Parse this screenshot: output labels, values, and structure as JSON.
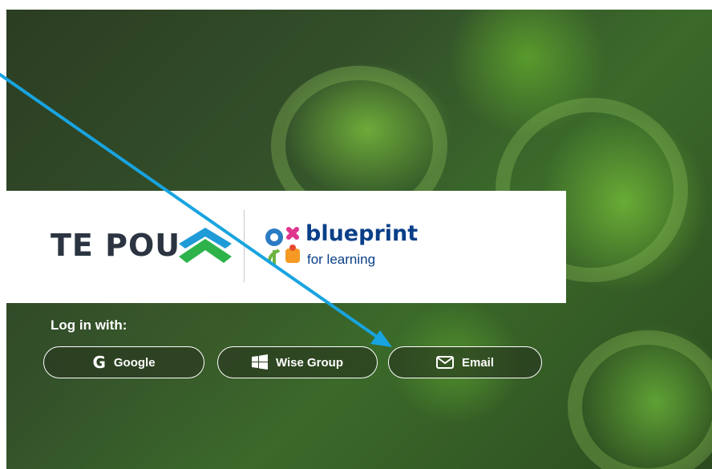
{
  "banner": {
    "left_brand": "TE POU",
    "right_brand_name": "blueprint",
    "right_brand_tagline": "for learning"
  },
  "login": {
    "label": "Log in with:",
    "buttons": [
      {
        "label": "Google",
        "icon": "google-g-icon"
      },
      {
        "label": "Wise Group",
        "icon": "windows-icon"
      },
      {
        "label": "Email",
        "icon": "envelope-icon"
      }
    ]
  },
  "annotation": {
    "arrow_color": "#18a4e0"
  }
}
